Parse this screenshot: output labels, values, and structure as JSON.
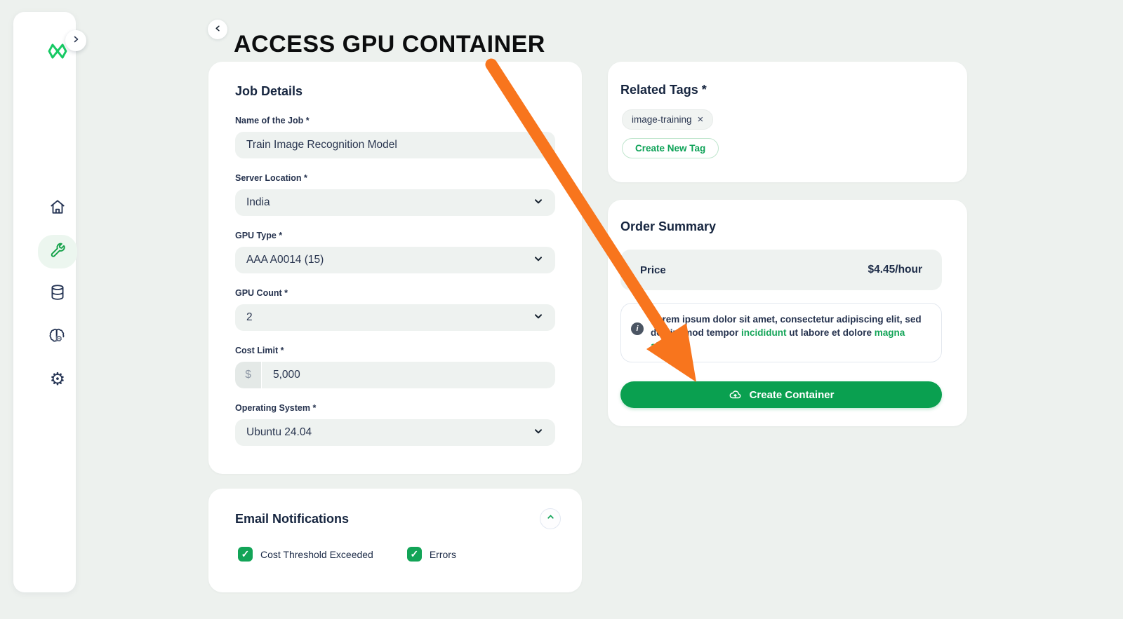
{
  "page": {
    "title": "ACCESS GPU CONTAINER"
  },
  "sidebar": {
    "logo": "infinity-logo",
    "items": [
      {
        "name": "home",
        "active": false
      },
      {
        "name": "tools",
        "active": true
      },
      {
        "name": "database",
        "active": false
      },
      {
        "name": "ai-models",
        "active": false
      },
      {
        "name": "settings",
        "active": false
      }
    ]
  },
  "job_details": {
    "title": "Job Details",
    "fields": [
      {
        "label": "Name of the Job *",
        "value": "Train Image Recognition Model",
        "type": "text"
      },
      {
        "label": "Server Location *",
        "value": "India",
        "type": "select"
      },
      {
        "label": "GPU Type *",
        "value": "AAA A0014 (15)",
        "type": "select"
      },
      {
        "label": "GPU Count *",
        "value": "2",
        "type": "select"
      },
      {
        "label": "Cost Limit *",
        "prefix": "$",
        "value": "5,000",
        "type": "text"
      },
      {
        "label": "Operating System *",
        "value": "Ubuntu 24.04",
        "type": "select"
      }
    ]
  },
  "email_notifications": {
    "title": "Email Notifications",
    "checkboxes": [
      {
        "label": "Cost Threshold Exceeded",
        "checked": true
      },
      {
        "label": "Errors",
        "checked": true
      }
    ]
  },
  "related_tags": {
    "title": "Related Tags *",
    "tags": [
      {
        "label": "image-training"
      }
    ],
    "create_button_label": "Create New Tag"
  },
  "order_summary": {
    "title": "Order Summary",
    "price_label": "Price",
    "price_value": "$4.45/hour",
    "info_parts": [
      {
        "text": "Lorem ipsum dolor sit amet, consectetur adipiscing elit, sed do eiusmod tempor "
      },
      {
        "text": "incididunt",
        "green": true
      },
      {
        "text": " ut labore et dolore "
      },
      {
        "text": "magna aliqua",
        "green": true
      },
      {
        "text": "."
      }
    ],
    "cta_label": "Create Container"
  },
  "icons": {
    "check": "✓",
    "close": "×",
    "info": "i",
    "gear": "⚙",
    "mini_gear": "⚙"
  },
  "colors": {
    "background": "#edf1ee",
    "accent_green": "#0aa050",
    "logo_green": "#17c964",
    "navy_text": "#1c2b47",
    "input_bg": "#eef2f0",
    "arrow_orange": "#f8751d",
    "checkbox_green": "#12a457"
  }
}
